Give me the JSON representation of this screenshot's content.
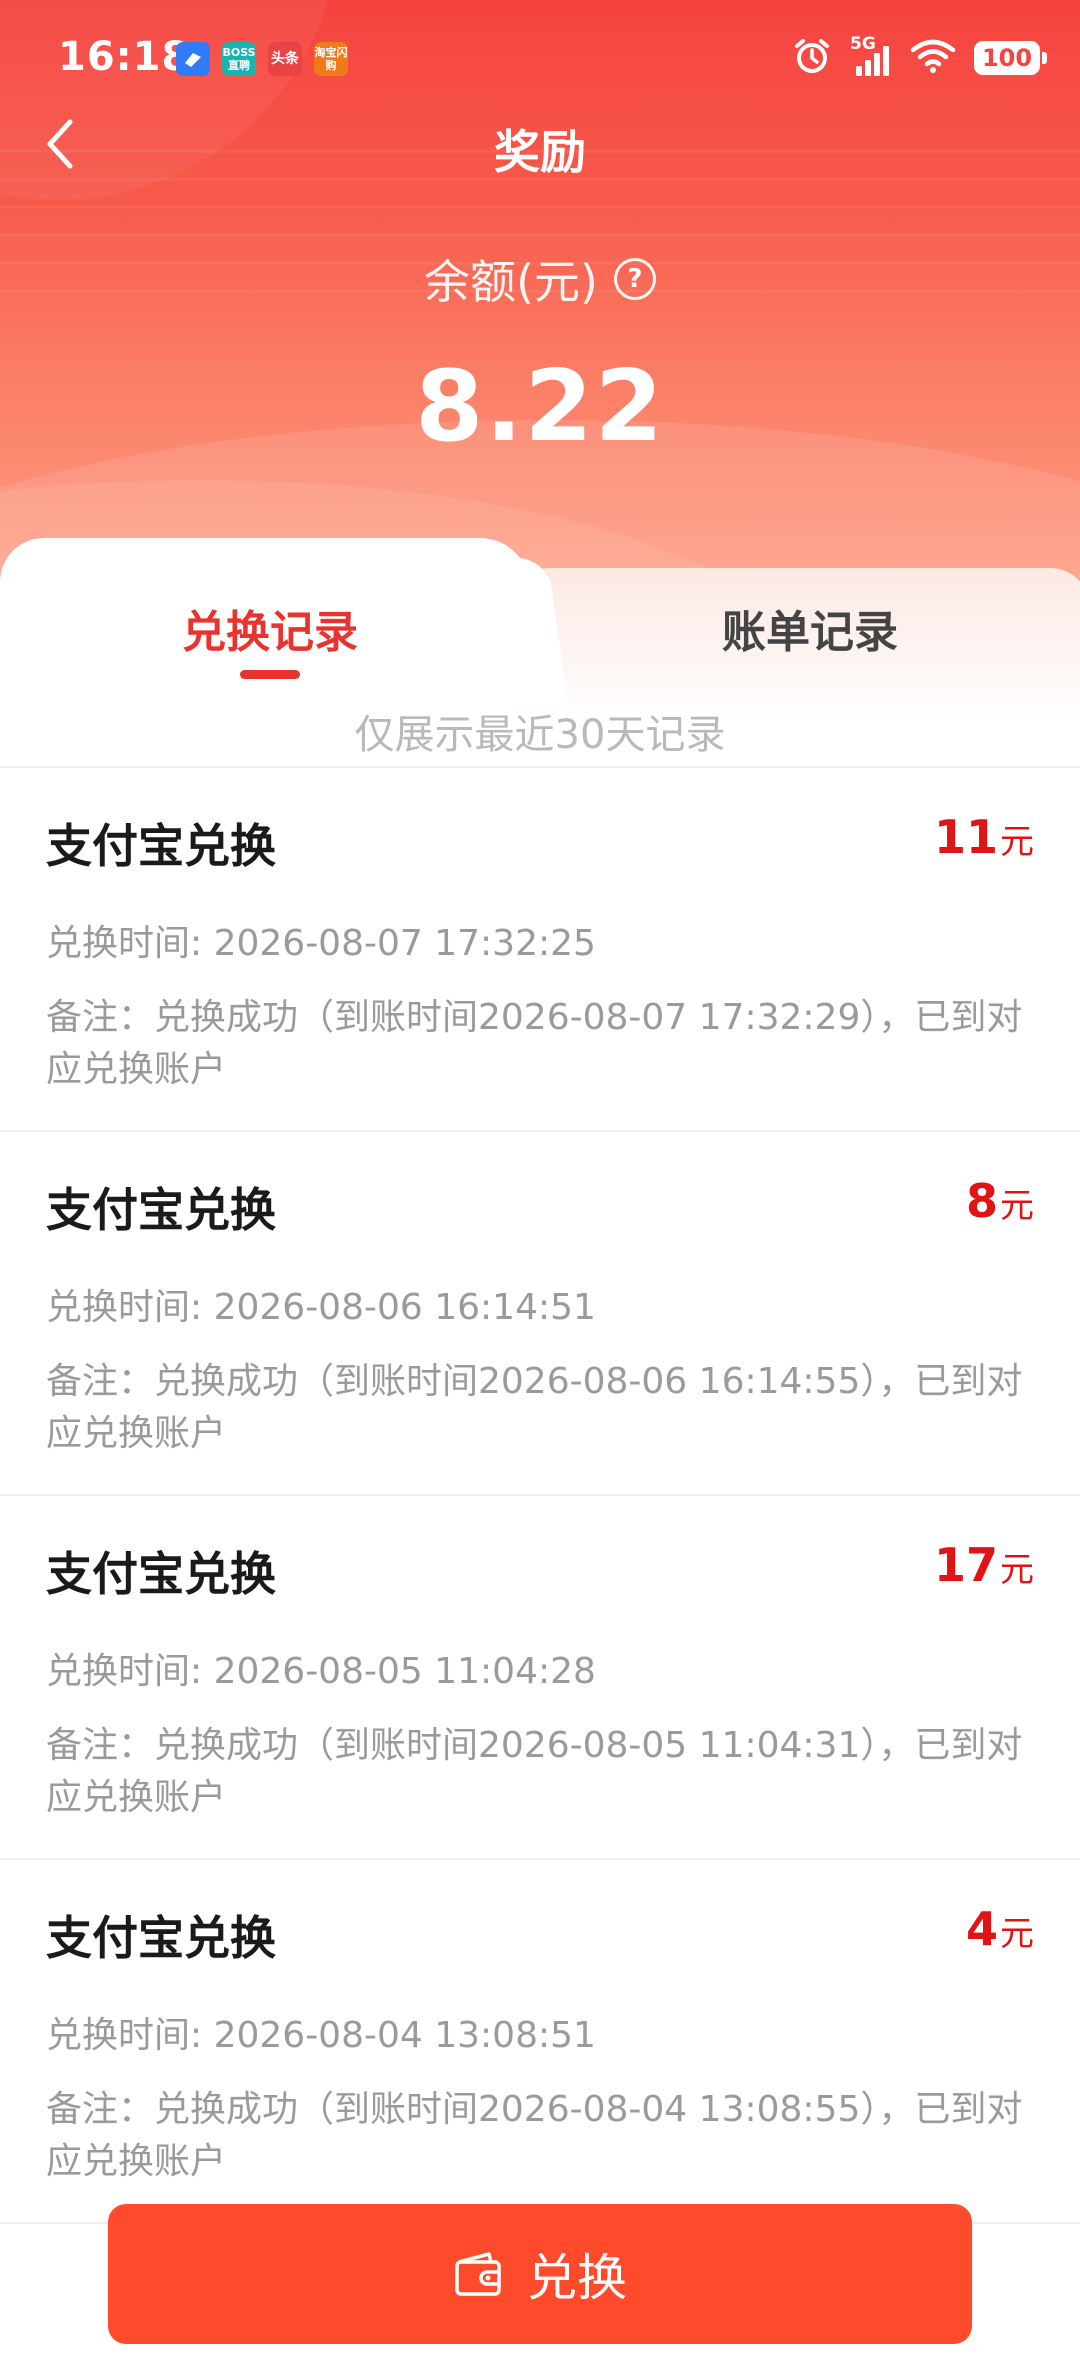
{
  "status_bar": {
    "time": "16:18",
    "apps": [
      {
        "label": "",
        "color": "#2f7cf6"
      },
      {
        "label": "BOSS直聘",
        "color": "#19b3b0"
      },
      {
        "label": "头条",
        "color": "#e94343"
      },
      {
        "label": "淘宝闪购",
        "color": "#f07a1a"
      }
    ],
    "network": "5G",
    "battery": "100",
    "icons": [
      "alarm-icon",
      "signal-icon",
      "wifi-icon",
      "battery-icon"
    ]
  },
  "nav": {
    "back_icon": "chevron-left-icon",
    "title": "奖励"
  },
  "balance": {
    "label": "余额(元)",
    "help_icon": "question-circle-icon",
    "help_glyph": "?",
    "value": "8.22"
  },
  "tabs": [
    {
      "label": "兑换记录",
      "active": true
    },
    {
      "label": "账单记录",
      "active": false
    }
  ],
  "note": "仅展示最近30天记录",
  "records": [
    {
      "title": "支付宝兑换",
      "amount": "11",
      "unit": "元",
      "time": "兑换时间: 2026-08-07 17:32:25",
      "remark": "备注：兑换成功（到账时间2026-08-07 17:32:29），已到对应兑换账户"
    },
    {
      "title": "支付宝兑换",
      "amount": "8",
      "unit": "元",
      "time": "兑换时间: 2026-08-06 16:14:51",
      "remark": "备注：兑换成功（到账时间2026-08-06 16:14:55），已到对应兑换账户"
    },
    {
      "title": "支付宝兑换",
      "amount": "17",
      "unit": "元",
      "time": "兑换时间: 2026-08-05 11:04:28",
      "remark": "备注：兑换成功（到账时间2026-08-05 11:04:31），已到对应兑换账户"
    },
    {
      "title": "支付宝兑换",
      "amount": "4",
      "unit": "元",
      "time": "兑换时间: 2026-08-04 13:08:51",
      "remark": "备注：兑换成功（到账时间2026-08-04 13:08:55），已到对应兑换账户"
    }
  ],
  "exchange_button": {
    "label": "兑换",
    "icon": "wallet-icon"
  },
  "colors": {
    "header_red": "#f5433f",
    "accent_red": "#e8332f",
    "amount_red": "#e01414",
    "button": "#ff4a2c"
  }
}
